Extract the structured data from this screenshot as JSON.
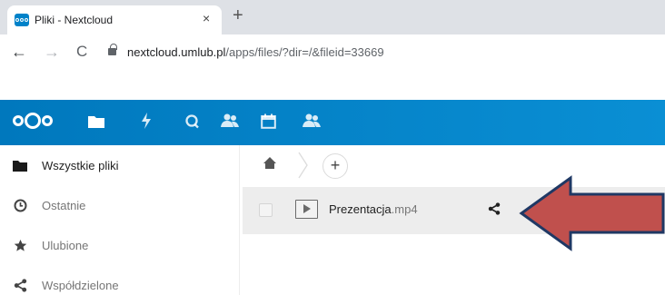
{
  "browser": {
    "tab_title": "Pliki - Nextcloud",
    "tab_close": "×",
    "new_tab": "+",
    "nav_back": "←",
    "nav_forward": "→",
    "nav_reload": "C",
    "url_host": "nextcloud.umlub.pl",
    "url_path": "/apps/files/?dir=/&fileid=33669"
  },
  "header": {
    "brand_color": "#0082c9",
    "apps": [
      {
        "name": "files-icon"
      },
      {
        "name": "activity-icon"
      },
      {
        "name": "search-icon"
      },
      {
        "name": "contacts-icon"
      },
      {
        "name": "calendar-icon"
      },
      {
        "name": "circles-icon"
      }
    ]
  },
  "sidebar": {
    "items": [
      {
        "label": "Wszystkie pliki",
        "icon": "folder-icon",
        "active": true
      },
      {
        "label": "Ostatnie",
        "icon": "clock-icon"
      },
      {
        "label": "Ulubione",
        "icon": "star-icon"
      },
      {
        "label": "Współdzielone",
        "icon": "share-icon"
      }
    ]
  },
  "breadcrumb": {
    "add_label": "+"
  },
  "files": [
    {
      "name": "Prezentacja",
      "ext": ".mp4",
      "icon": "video-file-icon"
    }
  ],
  "annotation": {
    "arrow_color": "#c0504d",
    "arrow_border": "#1f3864"
  }
}
